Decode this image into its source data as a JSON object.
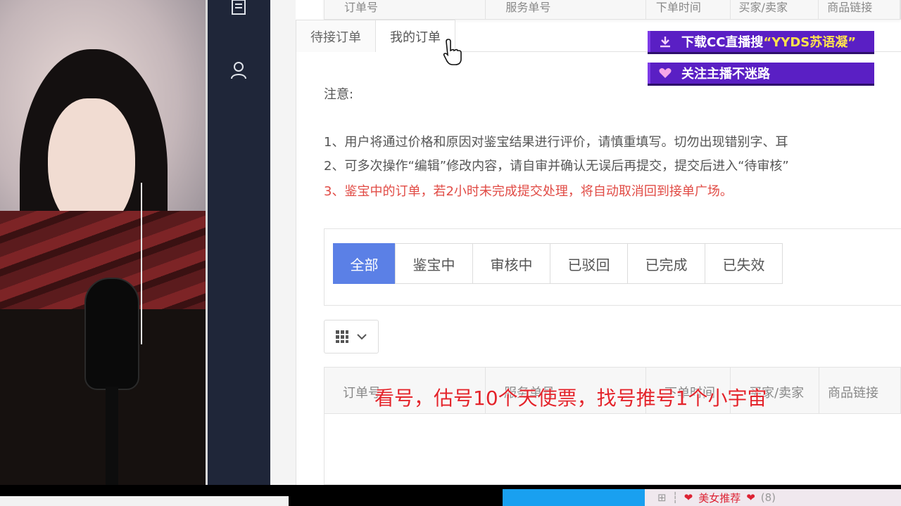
{
  "top_header": {
    "columns": [
      "订单号",
      "服务单号",
      "下单时间",
      "买家/卖家",
      "商品链接"
    ]
  },
  "tabs": [
    {
      "label": "待接订单",
      "active": false
    },
    {
      "label": "我的订单",
      "active": true
    }
  ],
  "notice": {
    "title": "注意:",
    "line1": "1、用户将通过价格和原因对鉴宝结果进行评价，请慎重填写。切勿出现错别字、耳",
    "line2": "2、可多次操作“编辑”修改内容，请自审并确认无误后再提交，提交后进入“待审核”",
    "line3": "3、鉴宝中的订单，若2小时未完成提交处理，将自动取消回到接单广场。"
  },
  "filters": [
    {
      "label": "全部",
      "active": true
    },
    {
      "label": "鉴宝中",
      "active": false
    },
    {
      "label": "审核中",
      "active": false
    },
    {
      "label": "已驳回",
      "active": false
    },
    {
      "label": "已完成",
      "active": false
    },
    {
      "label": "已失效",
      "active": false
    }
  ],
  "table": {
    "columns": [
      "订单号",
      "服务单号",
      "下单时间",
      "买家/卖家",
      "商品链接"
    ]
  },
  "subtitle": "看号，估号10个天使票，找号推号1个小宇宙",
  "overlay": {
    "banner1_prefix": "下载CC直播搜",
    "banner1_highlight": "“YYDS苏语凝”",
    "banner2": "关注主播不迷路"
  },
  "bottom_bar": {
    "label": "美女推荐",
    "count": "(8)"
  },
  "colors": {
    "accent": "#5b80e6",
    "warning_red": "#e14b45",
    "sidebar": "#1f2639",
    "banner_purple": "#5a1fc4"
  }
}
